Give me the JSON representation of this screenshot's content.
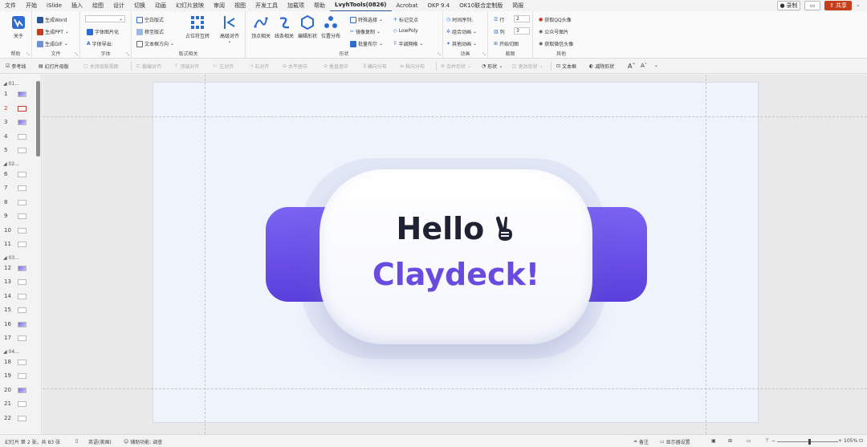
{
  "menu": {
    "tabs": [
      "文件",
      "开始",
      "iSlide",
      "插入",
      "绘图",
      "设计",
      "切换",
      "动画",
      "幻灯片放映",
      "审阅",
      "视图",
      "开发工具",
      "加载项",
      "帮助",
      "LvyhTools(0826)",
      "Acrobat",
      "OKP 9.4",
      "OK10联合定制版",
      "简报"
    ],
    "active_tab": "LvyhTools(0826)",
    "record": "录制",
    "share": "共享"
  },
  "ribbon": {
    "help": {
      "about": "关于",
      "label": "帮助"
    },
    "file": {
      "word": "生成Word",
      "ppt": "生成PPT",
      "gif": "生成GIF",
      "label": "文件"
    },
    "font": {
      "pic": "字体图片化",
      "export": "字体导出:",
      "label": "字体"
    },
    "layout": {
      "blank": "空白版式",
      "master": "移至版式",
      "textdir": "文本框方向",
      "placeholder": "占位符互转",
      "label": "版式相关"
    },
    "align": {
      "high": "高级对齐"
    },
    "shape": {
      "vertex": "顶点相关",
      "line": "线条相关",
      "edit": "编辑形状",
      "dist": "位置分布",
      "special": "特殊选择",
      "mirror": "镜像复制",
      "batch": "批量布尔",
      "marker": "标记交点",
      "lowpoly": "LowPoly",
      "grid": "半调网格",
      "label": "形状"
    },
    "anim": {
      "seq": "时间序列:",
      "combo": "组合动画",
      "other": "其他动画",
      "label": "动画"
    },
    "crop": {
      "row": "行",
      "row_val": "2",
      "col": "列",
      "col_val": "3",
      "start": "开始切图",
      "label": "裁图"
    },
    "other": {
      "qq": "获取QQ头像",
      "account": "公众号图片",
      "wechat": "获取微信头像",
      "label": "其他"
    }
  },
  "qbar": {
    "guides": "参考线",
    "master": "幻灯片母版",
    "close_master": "关闭母版视图",
    "crop_align": "裁编对齐",
    "top_align": "顶端对齐",
    "left_align": "左对齐",
    "right_align": "右对齐",
    "h_center": "水平居中",
    "v_center": "垂直居中",
    "h_dist": "横向分布",
    "v_dist": "纵向分布",
    "merge": "合并形状",
    "shape": "形状",
    "change_shape": "更改形状",
    "textbox": "文本框",
    "subtract": "减除形状"
  },
  "slides": {
    "sections": [
      "01...",
      "02...",
      "03...",
      "04..."
    ],
    "numbers": [
      "1",
      "2",
      "3",
      "4",
      "5",
      "6",
      "7",
      "8",
      "9",
      "10",
      "11",
      "12",
      "13",
      "14",
      "15",
      "16",
      "17",
      "18",
      "19",
      "20",
      "21",
      "22"
    ],
    "selected": 2
  },
  "slide": {
    "line1": "Hello",
    "line2": "Claydeck!",
    "colors": {
      "wing": "#6a4be0",
      "text_dark": "#1f2233",
      "text_purple": "#6a4be0"
    }
  },
  "status": {
    "slide_info": "幻灯片 第 2 张，共 83 张",
    "lang": "英语(美国)",
    "access": "辅助功能: 调查",
    "notes": "备注",
    "display": "显示器设置",
    "zoom": "105%"
  }
}
